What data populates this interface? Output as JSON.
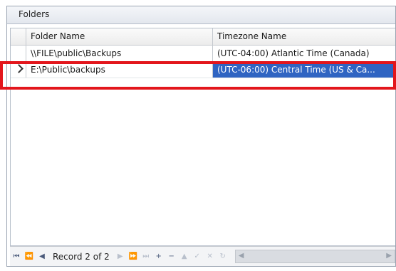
{
  "panel": {
    "title": "Folders"
  },
  "grid": {
    "columns": [
      "Folder Name",
      "Timezone Name"
    ],
    "rows": [
      {
        "folder": "\\\\FILE\\public\\Backups",
        "timezone": "(UTC-04:00) Atlantic Time (Canada)"
      },
      {
        "folder": "E:\\Public\\backups",
        "timezone": "(UTC-06:00) Central Time (US & Ca..."
      }
    ],
    "selected_row": 2
  },
  "navigator": {
    "record_text": "Record 2 of 2",
    "buttons": {
      "first": "⏮",
      "prev_page": "⏪",
      "prev": "◀",
      "next": "▶",
      "next_page": "⏩",
      "last": "⏭",
      "add": "+",
      "delete": "−",
      "edit": "▲",
      "save": "✓",
      "cancel": "✕",
      "refresh": "↻"
    }
  }
}
